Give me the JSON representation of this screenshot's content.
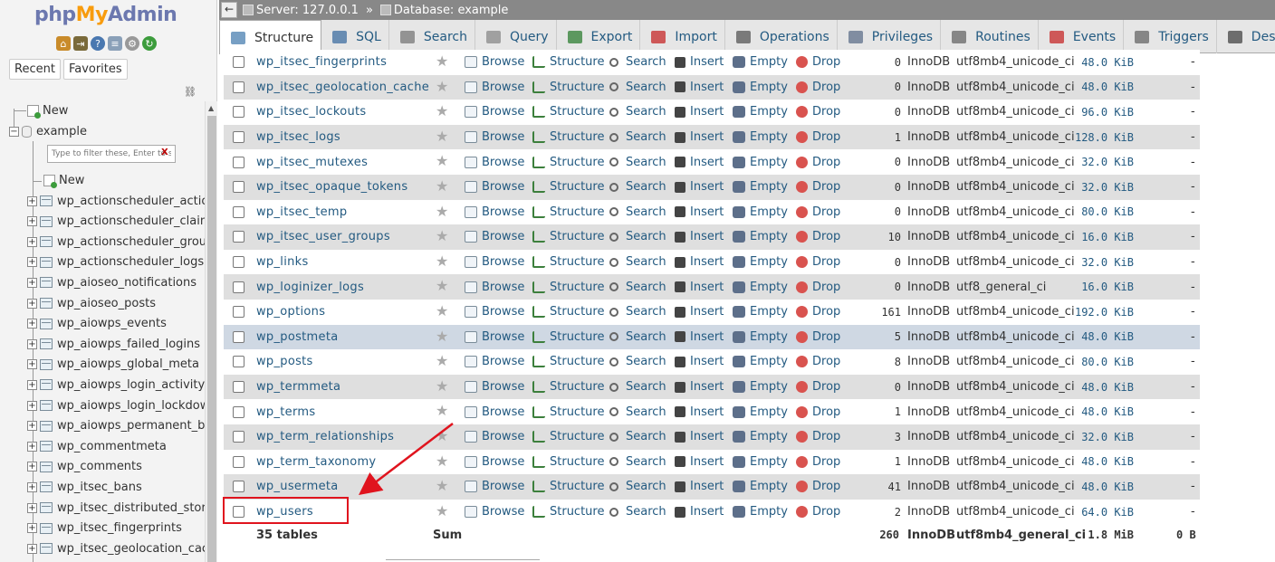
{
  "app": {
    "logo_php": "php",
    "logo_my": "My",
    "logo_admin": "Admin"
  },
  "left": {
    "tabs": [
      "Recent",
      "Favorites"
    ],
    "root_new": "New",
    "database": "example",
    "db_new": "New",
    "filter_placeholder": "Type to filter these, Enter to search all",
    "filter_clear": "X",
    "tables": [
      "wp_actionscheduler_action",
      "wp_actionscheduler_claim",
      "wp_actionscheduler_group",
      "wp_actionscheduler_logs",
      "wp_aioseo_notifications",
      "wp_aioseo_posts",
      "wp_aiowps_events",
      "wp_aiowps_failed_logins",
      "wp_aiowps_global_meta",
      "wp_aiowps_login_activity",
      "wp_aiowps_login_lockdow",
      "wp_aiowps_permanent_blo",
      "wp_commentmeta",
      "wp_comments",
      "wp_itsec_bans",
      "wp_itsec_distributed_stora",
      "wp_itsec_fingerprints",
      "wp_itsec_geolocation_cac"
    ]
  },
  "breadcrumb": {
    "server": "Server: 127.0.0.1",
    "separator": "»",
    "database": "Database: example"
  },
  "menu": {
    "tabs": [
      "Structure",
      "SQL",
      "Search",
      "Query",
      "Export",
      "Import",
      "Operations",
      "Privileges",
      "Routines",
      "Events",
      "Triggers",
      "Designer"
    ],
    "active": "Structure",
    "colors": [
      "#4a7fb0",
      "#3d6ea0",
      "#777777",
      "#888888",
      "#2e7d32",
      "#c62828",
      "#555555",
      "#5d6f8a",
      "#666666",
      "#c62828",
      "#666666",
      "#444444"
    ]
  },
  "actions": {
    "browse": "Browse",
    "structure": "Structure",
    "search": "Search",
    "insert": "Insert",
    "empty": "Empty",
    "drop": "Drop"
  },
  "rows": [
    {
      "name": "wp_itsec_fingerprints",
      "rows": "0",
      "engine": "InnoDB",
      "collation": "utf8mb4_unicode_ci",
      "size": "48.0 KiB",
      "overhead": "-"
    },
    {
      "name": "wp_itsec_geolocation_cache",
      "rows": "0",
      "engine": "InnoDB",
      "collation": "utf8mb4_unicode_ci",
      "size": "48.0 KiB",
      "overhead": "-"
    },
    {
      "name": "wp_itsec_lockouts",
      "rows": "0",
      "engine": "InnoDB",
      "collation": "utf8mb4_unicode_ci",
      "size": "96.0 KiB",
      "overhead": "-"
    },
    {
      "name": "wp_itsec_logs",
      "rows": "1",
      "engine": "InnoDB",
      "collation": "utf8mb4_unicode_ci",
      "size": "128.0 KiB",
      "overhead": "-"
    },
    {
      "name": "wp_itsec_mutexes",
      "rows": "0",
      "engine": "InnoDB",
      "collation": "utf8mb4_unicode_ci",
      "size": "32.0 KiB",
      "overhead": "-"
    },
    {
      "name": "wp_itsec_opaque_tokens",
      "rows": "0",
      "engine": "InnoDB",
      "collation": "utf8mb4_unicode_ci",
      "size": "32.0 KiB",
      "overhead": "-"
    },
    {
      "name": "wp_itsec_temp",
      "rows": "0",
      "engine": "InnoDB",
      "collation": "utf8mb4_unicode_ci",
      "size": "80.0 KiB",
      "overhead": "-"
    },
    {
      "name": "wp_itsec_user_groups",
      "rows": "10",
      "engine": "InnoDB",
      "collation": "utf8mb4_unicode_ci",
      "size": "16.0 KiB",
      "overhead": "-"
    },
    {
      "name": "wp_links",
      "rows": "0",
      "engine": "InnoDB",
      "collation": "utf8mb4_unicode_ci",
      "size": "32.0 KiB",
      "overhead": "-"
    },
    {
      "name": "wp_loginizer_logs",
      "rows": "0",
      "engine": "InnoDB",
      "collation": "utf8_general_ci",
      "size": "16.0 KiB",
      "overhead": "-"
    },
    {
      "name": "wp_options",
      "rows": "161",
      "engine": "InnoDB",
      "collation": "utf8mb4_unicode_ci",
      "size": "192.0 KiB",
      "overhead": "-"
    },
    {
      "name": "wp_postmeta",
      "rows": "5",
      "engine": "InnoDB",
      "collation": "utf8mb4_unicode_ci",
      "size": "48.0 KiB",
      "overhead": "-",
      "highlight": true
    },
    {
      "name": "wp_posts",
      "rows": "8",
      "engine": "InnoDB",
      "collation": "utf8mb4_unicode_ci",
      "size": "80.0 KiB",
      "overhead": "-"
    },
    {
      "name": "wp_termmeta",
      "rows": "0",
      "engine": "InnoDB",
      "collation": "utf8mb4_unicode_ci",
      "size": "48.0 KiB",
      "overhead": "-"
    },
    {
      "name": "wp_terms",
      "rows": "1",
      "engine": "InnoDB",
      "collation": "utf8mb4_unicode_ci",
      "size": "48.0 KiB",
      "overhead": "-"
    },
    {
      "name": "wp_term_relationships",
      "rows": "3",
      "engine": "InnoDB",
      "collation": "utf8mb4_unicode_ci",
      "size": "32.0 KiB",
      "overhead": "-"
    },
    {
      "name": "wp_term_taxonomy",
      "rows": "1",
      "engine": "InnoDB",
      "collation": "utf8mb4_unicode_ci",
      "size": "48.0 KiB",
      "overhead": "-"
    },
    {
      "name": "wp_usermeta",
      "rows": "41",
      "engine": "InnoDB",
      "collation": "utf8mb4_unicode_ci",
      "size": "48.0 KiB",
      "overhead": "-"
    },
    {
      "name": "wp_users",
      "rows": "2",
      "engine": "InnoDB",
      "collation": "utf8mb4_unicode_ci",
      "size": "64.0 KiB",
      "overhead": "-"
    }
  ],
  "footer": {
    "tables": "35 tables",
    "sum": "Sum",
    "rows": "260",
    "engine": "InnoDB",
    "collation": "utf8mb4_general_ci",
    "size": "1.8 MiB",
    "overhead": "0 B"
  },
  "annotation": {
    "highlight_color": "#e0141e",
    "target": "wp_users"
  }
}
